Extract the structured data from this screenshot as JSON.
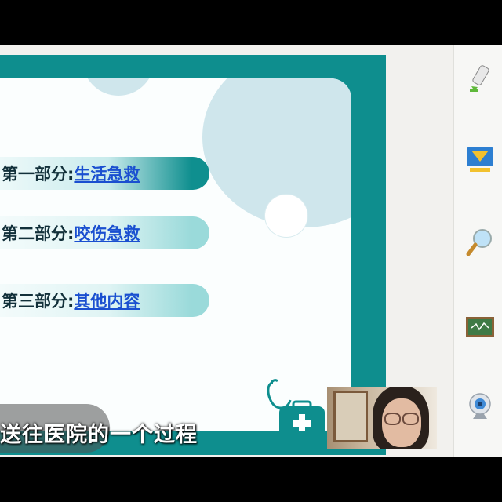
{
  "slide": {
    "items": [
      {
        "prefix": "第一部分: ",
        "link": "生活急救"
      },
      {
        "prefix": "第二部分: ",
        "link": "咬伤急救"
      },
      {
        "prefix": "第三部分: ",
        "link": "其他内容"
      }
    ]
  },
  "subtitle": "送往医院的一个过程",
  "toolbar": {
    "tools": [
      "pen-icon",
      "presentation-icon",
      "magnifier-icon",
      "chalkboard-icon",
      "webcam-icon"
    ]
  },
  "colors": {
    "teal": "#0e8e8e",
    "link": "#1a4fd0"
  }
}
